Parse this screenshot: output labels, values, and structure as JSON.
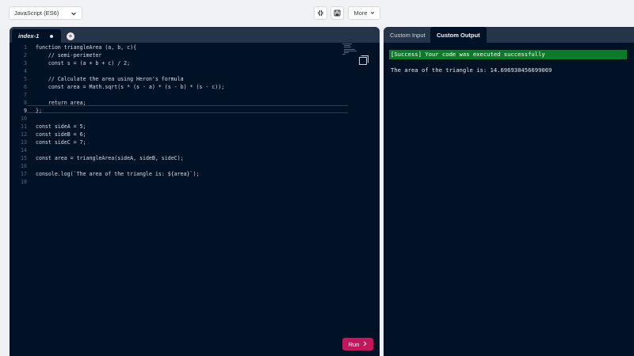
{
  "toolbar": {
    "language": "JavaScript (ES6)",
    "more_label": "More"
  },
  "editor": {
    "tab_name": "index-1",
    "line_numbers": [
      "1",
      "2",
      "3",
      "4",
      "5",
      "6",
      "7",
      "8",
      "9",
      "10",
      "11",
      "12",
      "13",
      "14",
      "15",
      "16",
      "17",
      "18"
    ],
    "active_line": 9,
    "code": [
      "function triangleArea (a, b, c){",
      "    // semi-perimeter",
      "    const s = (a + b + c) / 2;",
      "",
      "    // Calculate the area using Heron's formula",
      "    const area = Math.sqrt(s * (s - a) * (s - b) * (s - c));",
      "",
      "    return area;",
      "};",
      "",
      "const sideA = 5;",
      "const sideB = 6;",
      "const sideC = 7;",
      "",
      "const area = triangleArea(sideA, sideB, sideC);",
      "",
      "console.log(`The area of the triangle is: ${area}`);",
      ""
    ],
    "run_label": "Run"
  },
  "output": {
    "tabs": [
      "Custom Input",
      "Custom Output"
    ],
    "active_tab": "Custom Output",
    "success_message": "[Success] Your code was executed successfully",
    "result": "The area of the triangle is: 14.696938456699069"
  }
}
